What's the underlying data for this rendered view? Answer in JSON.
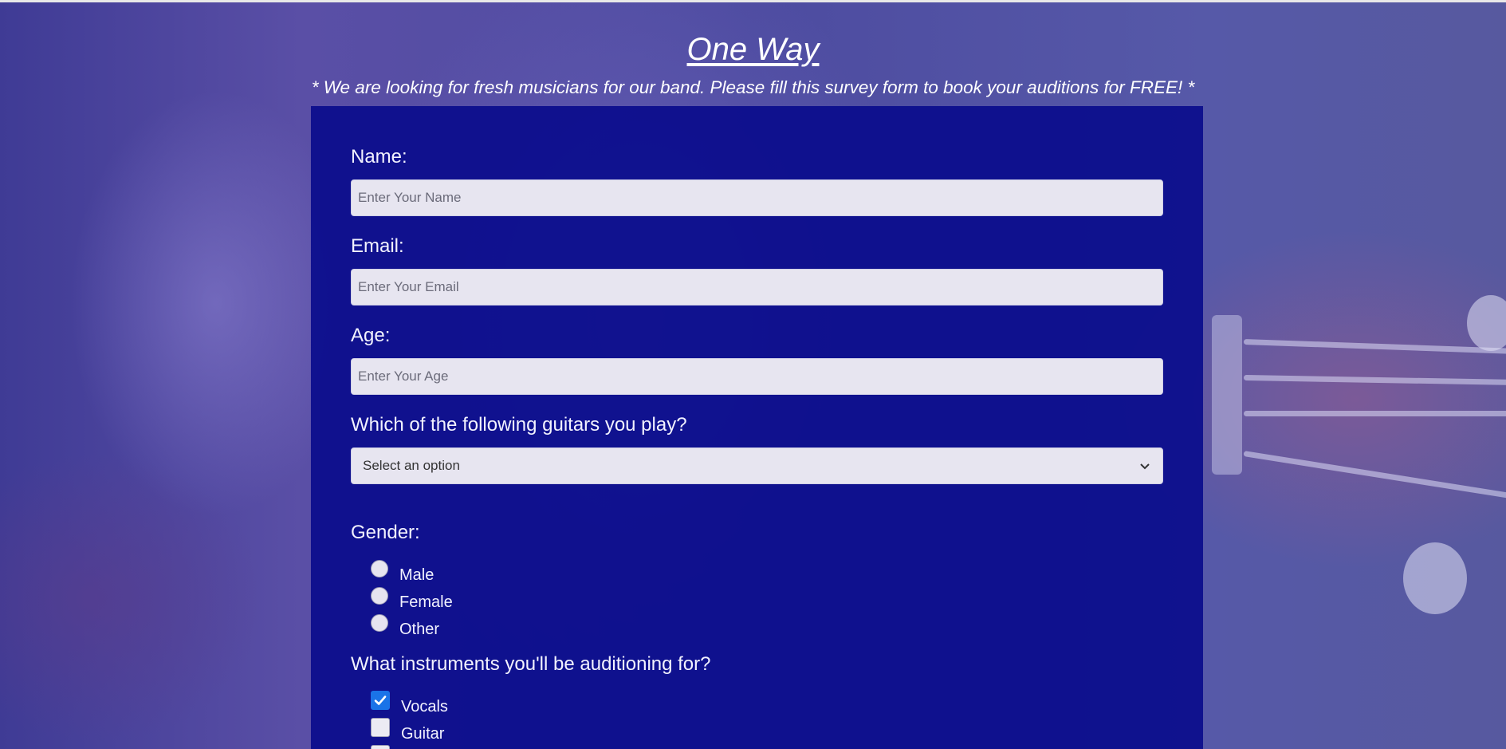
{
  "header": {
    "title": "One Way",
    "description": "* We are looking for fresh musicians for our band. Please fill this survey form to book your auditions for FREE! *"
  },
  "form": {
    "name": {
      "label": "Name:",
      "placeholder": "Enter Your Name"
    },
    "email": {
      "label": "Email:",
      "placeholder": "Enter Your Email"
    },
    "age": {
      "label": "Age:",
      "placeholder": "Enter Your Age"
    },
    "guitar": {
      "label": "Which of the following guitars you play?",
      "selected": "Select an option"
    },
    "gender": {
      "label": "Gender:",
      "options": [
        "Male",
        "Female",
        "Other"
      ]
    },
    "instruments": {
      "label": "What instruments you'll be auditioning for?",
      "options": [
        {
          "label": "Vocals",
          "checked": true
        },
        {
          "label": "Guitar",
          "checked": false
        }
      ]
    }
  },
  "colors": {
    "form_background": "#0a0c8c",
    "checkbox_accent": "#1a73e8"
  }
}
